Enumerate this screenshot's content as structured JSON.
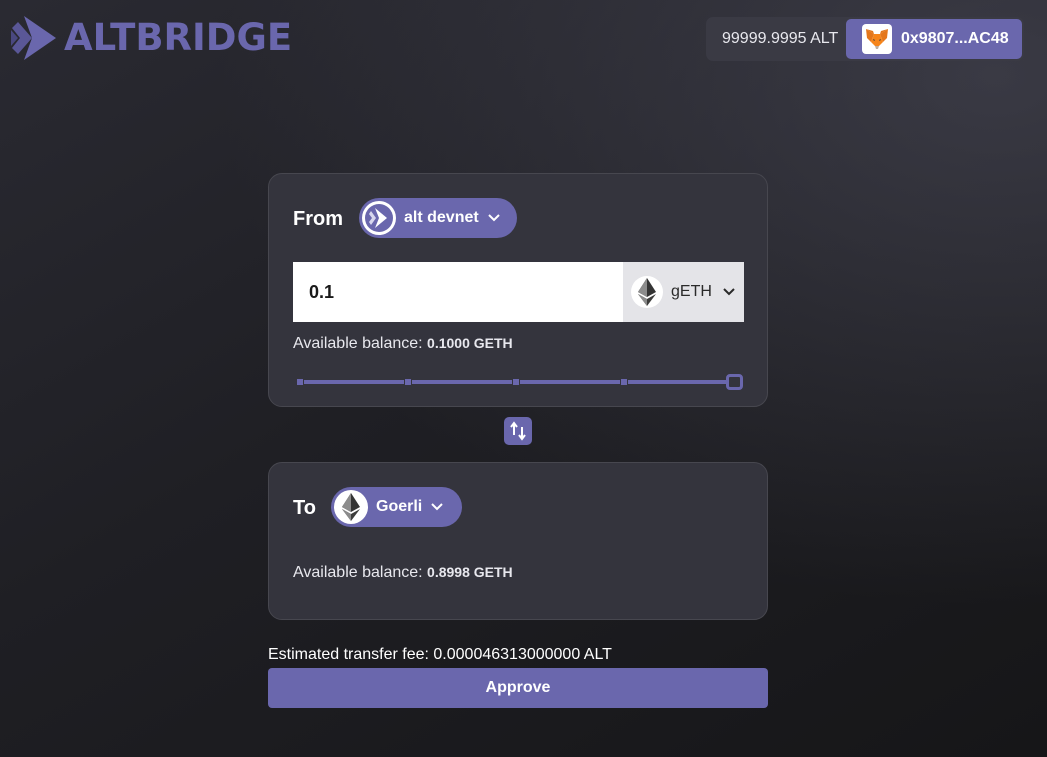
{
  "header": {
    "logo_text": "ALTBRIDGE",
    "wallet_balance": "99999.9995 ALT",
    "account_address": "0x9807...AC48"
  },
  "from": {
    "label": "From",
    "network": "alt devnet",
    "amount_value": "0.1",
    "token": "gETH",
    "available_label": "Available balance:",
    "available_value": "0.1000 GETH",
    "slider_fraction": 1.0
  },
  "to": {
    "label": "To",
    "network": "Goerli",
    "available_label": "Available balance:",
    "available_value": "0.8998 GETH"
  },
  "fee_text": "Estimated transfer fee: 0.000046313000000 ALT",
  "approve_label": "Approve",
  "colors": {
    "accent": "#6a67ad",
    "card": "#34343d",
    "wallet": "#3a3a44"
  }
}
